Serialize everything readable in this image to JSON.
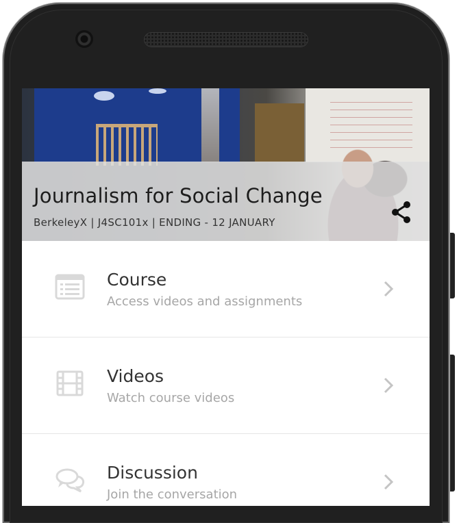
{
  "course": {
    "title": "Journalism for Social Change",
    "meta": "BerkeleyX | J4SC101x | ENDING - 12 JANUARY"
  },
  "menu": [
    {
      "title": "Course",
      "subtitle": "Access videos and assignments",
      "icon": "list-icon"
    },
    {
      "title": "Videos",
      "subtitle": "Watch course videos",
      "icon": "film-icon"
    },
    {
      "title": "Discussion",
      "subtitle": "Join the conversation",
      "icon": "comments-icon"
    }
  ],
  "icons": {
    "share": "share-icon",
    "chevron": "chevron-right-icon"
  },
  "colors": {
    "title": "#1d1d1d",
    "subtitle": "#a6a6a6",
    "icon": "#d9d9d9"
  }
}
